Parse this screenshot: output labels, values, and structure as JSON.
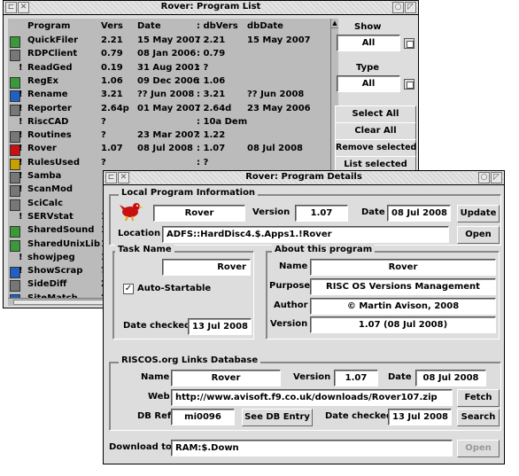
{
  "list_window": {
    "title": "Rover: Program List",
    "columns": [
      "Program",
      "Vers",
      "Date",
      ": dbVers",
      "dbDate"
    ],
    "rows": [
      {
        "flag": "",
        "icon": "green",
        "name": "QuickFiler",
        "vers": "2.21",
        "date": "15 May 2007",
        "dbvers": ": 2.21",
        "dbdate": "15 May 2007"
      },
      {
        "flag": "",
        "icon": "gray",
        "name": "RDPClient",
        "vers": "0.79",
        "date": "08 Jan 2006",
        "dbvers": ": 0.79",
        "dbdate": ""
      },
      {
        "flag": "!",
        "icon": "",
        "name": "ReadGed",
        "vers": "0.19",
        "date": "31 Aug 2001",
        "dbvers": ": ?",
        "dbdate": ""
      },
      {
        "flag": "",
        "icon": "green",
        "name": "RegEx",
        "vers": "1.06",
        "date": "09 Dec 2006",
        "dbvers": ": 1.06",
        "dbdate": ""
      },
      {
        "flag": "!",
        "icon": "blue",
        "name": "Rename",
        "vers": "3.21",
        "date": "?? Jun 2008",
        "dbvers": ": 3.21",
        "dbdate": "?? Jun 2008"
      },
      {
        "flag": "!",
        "icon": "gray",
        "name": "Reporter",
        "vers": "2.64p",
        "date": "01 May 2007",
        "dbvers": ": 2.64d",
        "dbdate": "23 May 2006"
      },
      {
        "flag": "!",
        "icon": "",
        "name": "RiscCAD",
        "vers": "?",
        "date": "",
        "dbvers": ": 10a Dem",
        "dbdate": ""
      },
      {
        "flag": "!",
        "icon": "gray",
        "name": "Routines",
        "vers": "?",
        "date": "23 Mar 2007",
        "dbvers": ": 1.22",
        "dbdate": ""
      },
      {
        "flag": "!",
        "icon": "red",
        "name": "Rover",
        "vers": "1.07",
        "date": "08 Jul 2008",
        "dbvers": ": 1.07",
        "dbdate": "08 Jul 2008"
      },
      {
        "flag": "!",
        "icon": "multi",
        "name": "RulesUsed",
        "vers": "?",
        "date": "",
        "dbvers": ": ?",
        "dbdate": ""
      },
      {
        "flag": "!",
        "icon": "gray",
        "name": "Samba",
        "vers": "",
        "date": "",
        "dbvers": "",
        "dbdate": ""
      },
      {
        "flag": "!",
        "icon": "gray",
        "name": "ScanMod",
        "vers": "",
        "date": "",
        "dbvers": "",
        "dbdate": ""
      },
      {
        "flag": "",
        "icon": "gray",
        "name": "SciCalc",
        "vers": "",
        "date": "",
        "dbvers": "",
        "dbdate": ""
      },
      {
        "flag": "!",
        "icon": "",
        "name": "SERVstat",
        "vers": "1",
        "date": "",
        "dbvers": "",
        "dbdate": ""
      },
      {
        "flag": "",
        "icon": "green",
        "name": "SharedSound",
        "vers": "1",
        "date": "",
        "dbvers": "",
        "dbdate": ""
      },
      {
        "flag": "",
        "icon": "green",
        "name": "SharedUnixLib",
        "vers": "1",
        "date": "",
        "dbvers": "",
        "dbdate": ""
      },
      {
        "flag": "!",
        "icon": "",
        "name": "showjpeg",
        "vers": "1",
        "date": "",
        "dbvers": "",
        "dbdate": ""
      },
      {
        "flag": "!",
        "icon": "blue",
        "name": "ShowScrap",
        "vers": "?",
        "date": "",
        "dbvers": "",
        "dbdate": ""
      },
      {
        "flag": "",
        "icon": "gray",
        "name": "SideDiff",
        "vers": "2",
        "date": "",
        "dbvers": "",
        "dbdate": ""
      },
      {
        "flag": "",
        "icon": "blue",
        "name": "SiteMatch",
        "vers": "2",
        "date": "",
        "dbvers": "",
        "dbdate": ""
      }
    ],
    "show_label": "Show",
    "show_value": "All",
    "type_label": "Type",
    "type_value": "All",
    "buttons": [
      "Select All",
      "Clear All",
      "Remove selected",
      "List selected"
    ]
  },
  "details_window": {
    "title": "Rover: Program Details",
    "local_group": "Local Program Information",
    "program_name": "Rover",
    "version_label": "Version",
    "version_value": "1.07",
    "date_label": "Date",
    "date_value": "08 Jul 2008",
    "update_button": "Update",
    "location_label": "Location",
    "location_value": "ADFS::HardDisc4.$.Apps1.!Rover",
    "open_button": "Open",
    "task_group": "Task Name",
    "task_value": "Rover",
    "auto_startable_label": "Auto-Startable",
    "auto_startable_mark": "✓",
    "date_checked_label": "Date checked",
    "date_checked_value": "13 Jul 2008",
    "about_group": "About this program",
    "about": {
      "name_label": "Name",
      "name_value": "Rover",
      "purpose_label": "Purpose",
      "purpose_value": "RISC OS Versions Management",
      "author_label": "Author",
      "author_value": "© Martin Avison, 2008",
      "version_label": "Version",
      "version_value": "1.07 (08 Jul 2008)"
    },
    "db_group": "RISCOS.org Links Database",
    "db": {
      "name_label": "Name",
      "name_value": "Rover",
      "version_label": "Version",
      "version_value": "1.07",
      "date_label": "Date",
      "date_value": "08 Jul 2008",
      "web_label": "Web",
      "web_value": "http://www.avisoft.f9.co.uk/downloads/Rover107.zip",
      "fetch_button": "Fetch",
      "dbref_label": "DB Ref",
      "dbref_value": "mi0096",
      "see_db_button": "See DB Entry",
      "checked_label": "Date checked",
      "checked_value": "13 Jul 2008",
      "search_button": "Search"
    },
    "download_label": "Download to",
    "download_value": "RAM:$.Down",
    "download_open_button": "Open"
  },
  "colors": {
    "window_bg": "#dddddd",
    "list_bg": "#bbbbbb",
    "green_icon": "#3a9a3a",
    "red_icon": "#c81010",
    "blue_icon": "#2060c0"
  }
}
